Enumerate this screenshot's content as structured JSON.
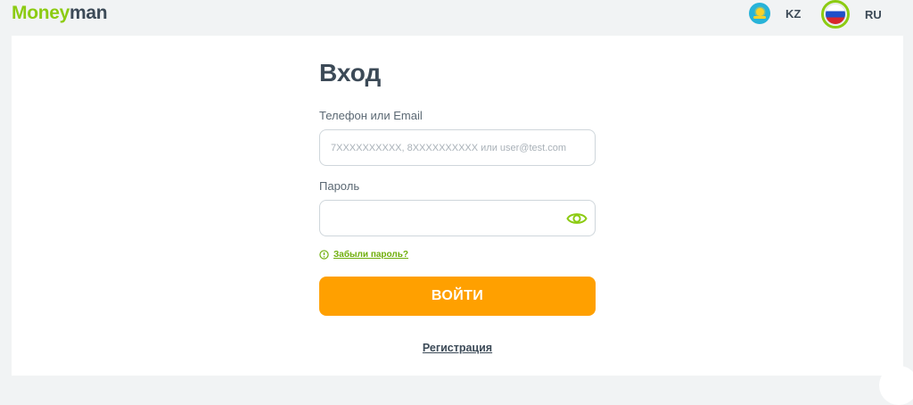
{
  "header": {
    "logo_part1": "Money",
    "logo_part2": "man",
    "languages": [
      {
        "code": "KZ",
        "label": "KZ",
        "flag": "kazakhstan-flag",
        "selected": false
      },
      {
        "code": "RU",
        "label": "RU",
        "flag": "russia-flag",
        "selected": true
      }
    ]
  },
  "login": {
    "title": "Вход",
    "login_field": {
      "label": "Телефон или Email",
      "placeholder": "7XXXXXXXXXX, 8XXXXXXXXXX или user@test.com",
      "value": ""
    },
    "password_field": {
      "label": "Пароль",
      "placeholder": "",
      "value": ""
    },
    "forgot_password": "Забыли пароль?",
    "submit_label": "ВОЙТИ",
    "register_link": "Регистрация"
  },
  "colors": {
    "brand_green": "#8ccb12",
    "link_green": "#6fae0b",
    "button_orange": "#ffa000",
    "text_dark": "#3c4a57",
    "page_background": "#f1f3f4"
  },
  "icons": {
    "password_toggle": "eye-icon",
    "forgot_password": "info-circle-icon"
  }
}
